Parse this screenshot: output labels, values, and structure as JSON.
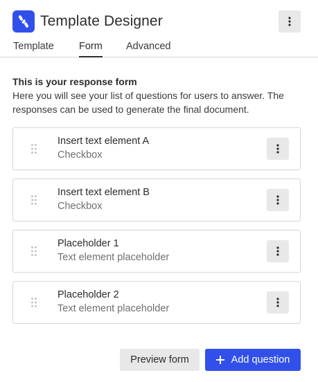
{
  "app": {
    "title": "Template Designer",
    "logo_color": "#3150ea"
  },
  "tabs": [
    {
      "label": "Template",
      "active": false
    },
    {
      "label": "Form",
      "active": true
    },
    {
      "label": "Advanced",
      "active": false
    }
  ],
  "intro": {
    "title": "This is your response form",
    "text": "Here you will see your list of questions for users to answer. The responses can be used to generate the final document."
  },
  "questions": [
    {
      "title": "Insert text element A",
      "type": "Checkbox"
    },
    {
      "title": "Insert text element B",
      "type": "Checkbox"
    },
    {
      "title": "Placeholder 1",
      "type": "Text element placeholder"
    },
    {
      "title": "Placeholder 2",
      "type": "Text element placeholder"
    }
  ],
  "footer": {
    "preview_label": "Preview form",
    "add_label": "Add question"
  },
  "icons": {
    "header_menu": "more-vertical-icon",
    "card_menu": "more-vertical-icon",
    "drag": "drag-handle-icon",
    "add": "plus-icon"
  },
  "colors": {
    "primary": "#3150ea",
    "secondary_button": "#e8e8e8",
    "border": "#d6d6d6"
  }
}
